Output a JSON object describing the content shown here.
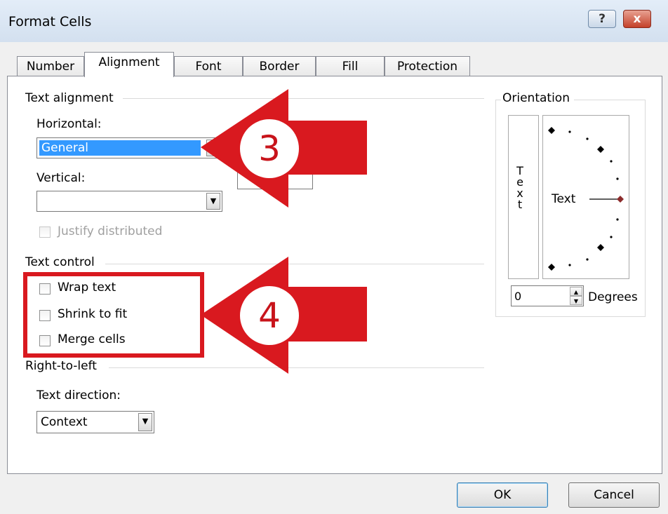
{
  "window": {
    "title": "Format Cells",
    "help_label": "?",
    "close_label": "x"
  },
  "tabs": [
    {
      "label": "Number"
    },
    {
      "label": "Alignment"
    },
    {
      "label": "Font"
    },
    {
      "label": "Border"
    },
    {
      "label": "Fill"
    },
    {
      "label": "Protection"
    }
  ],
  "text_alignment": {
    "group_label": "Text alignment",
    "horizontal_label": "Horizontal:",
    "horizontal_value": "General",
    "vertical_label": "Vertical:",
    "vertical_value": "",
    "justify_distributed_label": "Justify distributed"
  },
  "text_control": {
    "group_label": "Text control",
    "wrap_text_label": "Wrap text",
    "shrink_to_fit_label": "Shrink to fit",
    "merge_cells_label": "Merge cells"
  },
  "right_to_left": {
    "group_label": "Right-to-left",
    "text_direction_label": "Text direction:",
    "text_direction_value": "Context"
  },
  "orientation": {
    "group_label": "Orientation",
    "vertical_text": "Text",
    "dial_text": "Text",
    "degrees_value": "0",
    "degrees_label": "Degrees"
  },
  "buttons": {
    "ok_label": "OK",
    "cancel_label": "Cancel"
  },
  "annotations": {
    "arrow_3": "3",
    "arrow_4": "4",
    "color": "#d9191f"
  }
}
